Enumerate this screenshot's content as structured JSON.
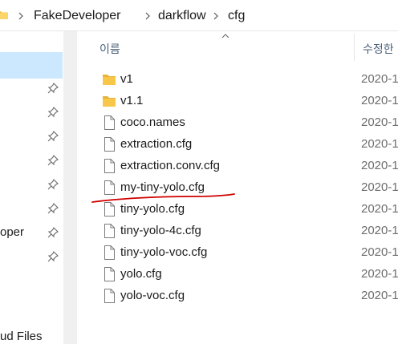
{
  "breadcrumb": {
    "items": [
      "FakeDeveloper",
      "darkflow",
      "cfg"
    ]
  },
  "nav": {
    "items": [
      {
        "label": "oper"
      },
      {
        "label": "ud Files"
      }
    ]
  },
  "columns": {
    "name": "이름",
    "date": "수정한"
  },
  "files": [
    {
      "name": "v1",
      "type": "folder",
      "date": "2020-1"
    },
    {
      "name": "v1.1",
      "type": "folder",
      "date": "2020-1"
    },
    {
      "name": "coco.names",
      "type": "file",
      "date": "2020-1"
    },
    {
      "name": "extraction.cfg",
      "type": "file",
      "date": "2020-1"
    },
    {
      "name": "extraction.conv.cfg",
      "type": "file",
      "date": "2020-1"
    },
    {
      "name": "my-tiny-yolo.cfg",
      "type": "file",
      "date": "2020-1"
    },
    {
      "name": "tiny-yolo.cfg",
      "type": "file",
      "date": "2020-1"
    },
    {
      "name": "tiny-yolo-4c.cfg",
      "type": "file",
      "date": "2020-1"
    },
    {
      "name": "tiny-yolo-voc.cfg",
      "type": "file",
      "date": "2020-1"
    },
    {
      "name": "yolo.cfg",
      "type": "file",
      "date": "2020-1"
    },
    {
      "name": "yolo-voc.cfg",
      "type": "file",
      "date": "2020-1"
    }
  ],
  "icons": {
    "folder": "folder-icon",
    "file": "file-icon",
    "pin": "pin-icon",
    "separator": "chevron-right-icon",
    "sort": "sort-up-icon"
  },
  "colors": {
    "folder": "#f8c74a",
    "selection": "#cce8ff",
    "annotation": "#d00000",
    "header_text": "#4c607a"
  }
}
